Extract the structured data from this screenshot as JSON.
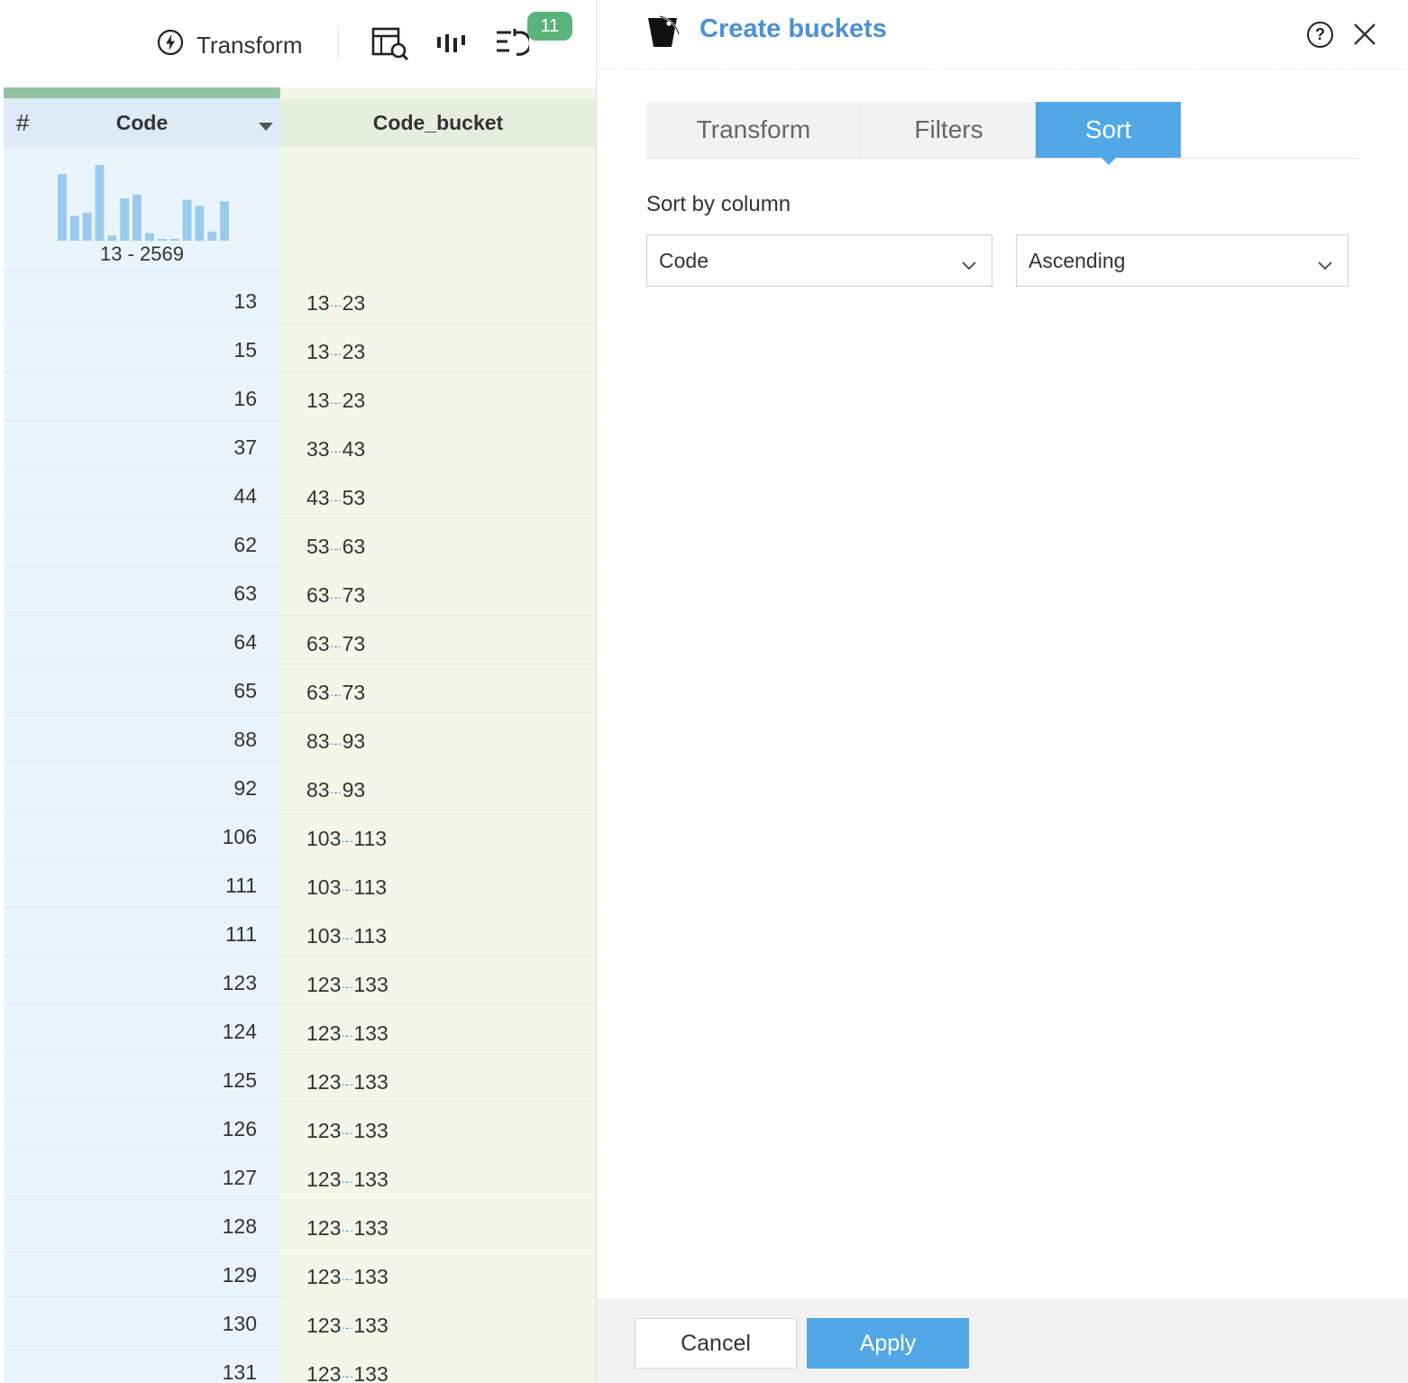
{
  "toolbar": {
    "transform_label": "Transform",
    "badge_count": "11",
    "icons": [
      "bolt-icon",
      "table-search-icon",
      "column-stats-icon",
      "history-icon"
    ]
  },
  "grid": {
    "code_header": "Code",
    "code_type_symbol": "#",
    "bucket_header": "Code_bucket",
    "histogram": {
      "range_label": "13 - 2569",
      "bar_heights_relative": [
        0.88,
        0.33,
        0.37,
        1.0,
        0.07,
        0.56,
        0.61,
        0.1,
        0.02,
        0.02,
        0.54,
        0.46,
        0.12,
        0.52
      ],
      "color": "#9bcbec"
    },
    "rows": [
      {
        "code": "13",
        "from": "13",
        "to": "23"
      },
      {
        "code": "15",
        "from": "13",
        "to": "23"
      },
      {
        "code": "16",
        "from": "13",
        "to": "23"
      },
      {
        "code": "37",
        "from": "33",
        "to": "43"
      },
      {
        "code": "44",
        "from": "43",
        "to": "53"
      },
      {
        "code": "62",
        "from": "53",
        "to": "63"
      },
      {
        "code": "63",
        "from": "63",
        "to": "73"
      },
      {
        "code": "64",
        "from": "63",
        "to": "73"
      },
      {
        "code": "65",
        "from": "63",
        "to": "73"
      },
      {
        "code": "88",
        "from": "83",
        "to": "93"
      },
      {
        "code": "92",
        "from": "83",
        "to": "93"
      },
      {
        "code": "106",
        "from": "103",
        "to": "113"
      },
      {
        "code": "111",
        "from": "103",
        "to": "113"
      },
      {
        "code": "111",
        "from": "103",
        "to": "113"
      },
      {
        "code": "123",
        "from": "123",
        "to": "133"
      },
      {
        "code": "124",
        "from": "123",
        "to": "133"
      },
      {
        "code": "125",
        "from": "123",
        "to": "133"
      },
      {
        "code": "126",
        "from": "123",
        "to": "133"
      },
      {
        "code": "127",
        "from": "123",
        "to": "133"
      },
      {
        "code": "128",
        "from": "123",
        "to": "133"
      },
      {
        "code": "129",
        "from": "123",
        "to": "133"
      },
      {
        "code": "130",
        "from": "123",
        "to": "133"
      },
      {
        "code": "131",
        "from": "123",
        "to": "133"
      }
    ]
  },
  "dialog": {
    "title": "Create buckets",
    "help_symbol": "?",
    "tabs": [
      "Transform",
      "Filters",
      "Sort"
    ],
    "active_tab": "Sort",
    "sort_by_label": "Sort by column",
    "column_select_value": "Code",
    "order_select_value": "Ascending",
    "cancel_label": "Cancel",
    "apply_label": "Apply",
    "accent_color": "#52a8e6",
    "title_color": "#4a90d9"
  }
}
